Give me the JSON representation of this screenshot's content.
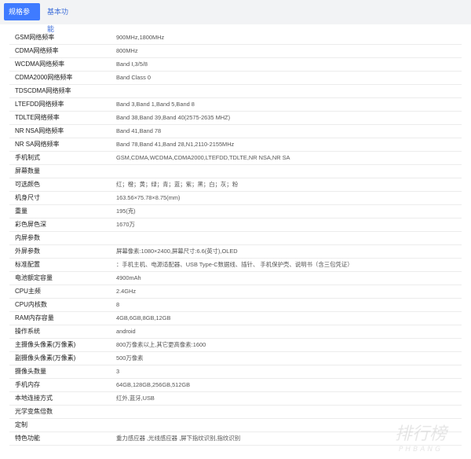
{
  "tabs": [
    {
      "label": "规格参数",
      "active": true
    },
    {
      "label": "基本功能",
      "active": false
    }
  ],
  "specs": [
    {
      "label": "GSM网络频率",
      "value": "900MHz,1800MHz"
    },
    {
      "label": "CDMA网络频率",
      "value": "800MHz"
    },
    {
      "label": "WCDMA网络频率",
      "value": "Band Ⅰ,3/5/8"
    },
    {
      "label": "CDMA2000网络频率",
      "value": "Band Class 0"
    },
    {
      "label": "TDSCDMA网络频率",
      "value": ""
    },
    {
      "label": "LTEFDD网络频率",
      "value": "Band 3,Band 1,Band 5,Band 8"
    },
    {
      "label": "TDLTE网络频率",
      "value": "Band 38,Band 39,Band 40(2575-2635 MHZ)"
    },
    {
      "label": "NR NSA网络频率",
      "value": "Band 41,Band 78"
    },
    {
      "label": "NR SA网络频率",
      "value": "Band 78,Band 41,Band 28,N1,2110-2155MHz"
    },
    {
      "label": "手机制式",
      "value": "GSM,CDMA,WCDMA,CDMA2000,LTEFDD,TDLTE,NR NSA,NR SA"
    },
    {
      "label": "屏幕数量",
      "value": ""
    },
    {
      "label": "可选颜色",
      "value": "红；橙；黄；绿；青；蓝；紫；黑；白；灰；粉"
    },
    {
      "label": "机身尺寸",
      "value": "163.56×75.78×8.75(mm)"
    },
    {
      "label": "重量",
      "value": "195(克)"
    },
    {
      "label": "彩色屏色深",
      "value": "1670万"
    },
    {
      "label": "内屏参数",
      "value": ""
    },
    {
      "label": "外屏参数",
      "value": "屏幕像素:1080×2400,屏幕尺寸:6.6(英寸),OLED"
    },
    {
      "label": "标准配置",
      "value": "：手机主机、电源适配器、USB Type-C数据线、插针、 手机保护壳、说明书（含三包凭证）"
    },
    {
      "label": "电池额定容量",
      "value": "4900mAh"
    },
    {
      "label": "CPU主频",
      "value": "2.4GHz"
    },
    {
      "label": "CPU内核数",
      "value": "8"
    },
    {
      "label": "RAM内存容量",
      "value": "4GB,6GB,8GB,12GB"
    },
    {
      "label": "操作系统",
      "value": "android"
    },
    {
      "label": "主摄像头像素(万像素)",
      "value": "800万像素以上,其它更高像素:1600"
    },
    {
      "label": "副摄像头像素(万像素)",
      "value": "500万像素"
    },
    {
      "label": "摄像头数量",
      "value": "3"
    },
    {
      "label": "手机内存",
      "value": "64GB,128GB,256GB,512GB"
    },
    {
      "label": "本地连接方式",
      "value": "红外,蓝牙,USB"
    },
    {
      "label": "光学变焦倍数",
      "value": ""
    },
    {
      "label": "定制",
      "value": ""
    },
    {
      "label": "特色功能",
      "value": "重力感应器 ,光线感应器 ,屏下指纹识别,指纹识别"
    }
  ],
  "watermark": {
    "text": "排行榜",
    "subtext": "PHBANG"
  }
}
